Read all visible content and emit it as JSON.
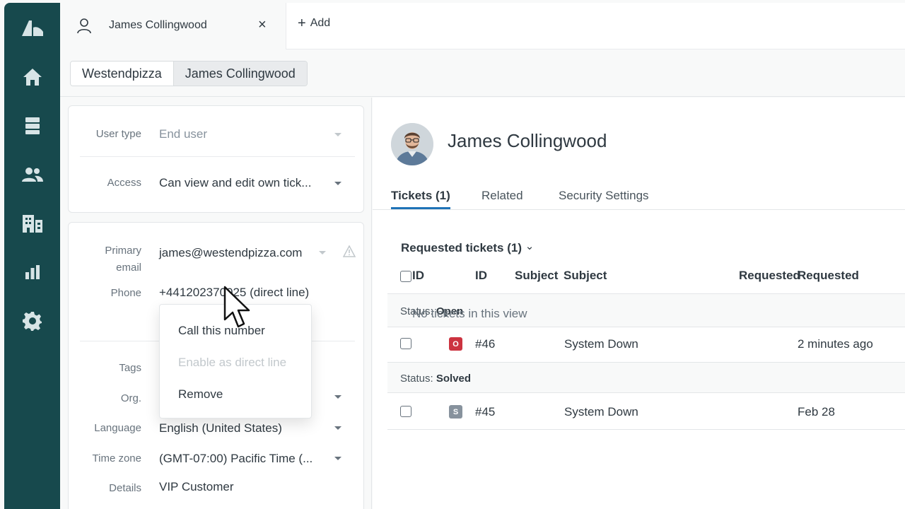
{
  "colors": {
    "nav_bg": "#17494d",
    "accent_blue": "#1f73b7",
    "status_open": "#cc3340",
    "status_solved": "#87929d"
  },
  "nav": {
    "icons": [
      "zendesk-logo-icon",
      "home-icon",
      "views-icon",
      "customers-icon",
      "organizations-icon",
      "reporting-icon",
      "settings-icon"
    ]
  },
  "tabbar": {
    "user_tab_label": "James Collingwood",
    "close_glyph": "×",
    "add_label": "Add",
    "add_glyph": "+"
  },
  "breadcrumbs": [
    "Westendpizza",
    "James Collingwood"
  ],
  "user_fields": {
    "user_type_label": "User type",
    "user_type_value": "End user",
    "access_label": "Access",
    "access_value": "Can view and edit own tick...",
    "primary_email_label_1": "Primary",
    "primary_email_label_2": "email",
    "primary_email_value": "james@westendpizza.com",
    "phone_label": "Phone",
    "phone_value": "+441202370025 (direct line)",
    "tags_label": "Tags",
    "org_label": "Org.",
    "language_label": "Language",
    "language_value": "English (United States)",
    "timezone_label": "Time zone",
    "timezone_value": "(GMT-07:00) Pacific Time (...",
    "details_label": "Details",
    "details_value": "VIP Customer"
  },
  "context_menu": {
    "items": [
      "Call this number",
      "Enable as direct line",
      "Remove"
    ]
  },
  "profile": {
    "name": "James Collingwood",
    "tabs": [
      "Tickets (1)",
      "Related",
      "Security Settings"
    ],
    "active_tab": 0
  },
  "tickets": {
    "section_title": "Requested tickets (1)",
    "section_caret": "⌄",
    "header_id_ghost": "ID",
    "header_id": "ID",
    "header_subject_ghost": "Subject",
    "header_subject": "Subject",
    "header_requested_ghost": "Requested",
    "header_requested": "Requested",
    "groups": [
      {
        "status_prefix": "Status:",
        "status_name": "Open",
        "empty_text": "No tickets in this view",
        "rows": [
          {
            "chip": "O",
            "id": "#46",
            "subject": "System Down",
            "requested": "2 minutes ago"
          }
        ]
      },
      {
        "status_prefix": "Status:",
        "status_name": "Solved",
        "rows": [
          {
            "chip": "S",
            "id": "#45",
            "subject": "System Down",
            "requested": "Feb 28"
          }
        ]
      }
    ]
  }
}
